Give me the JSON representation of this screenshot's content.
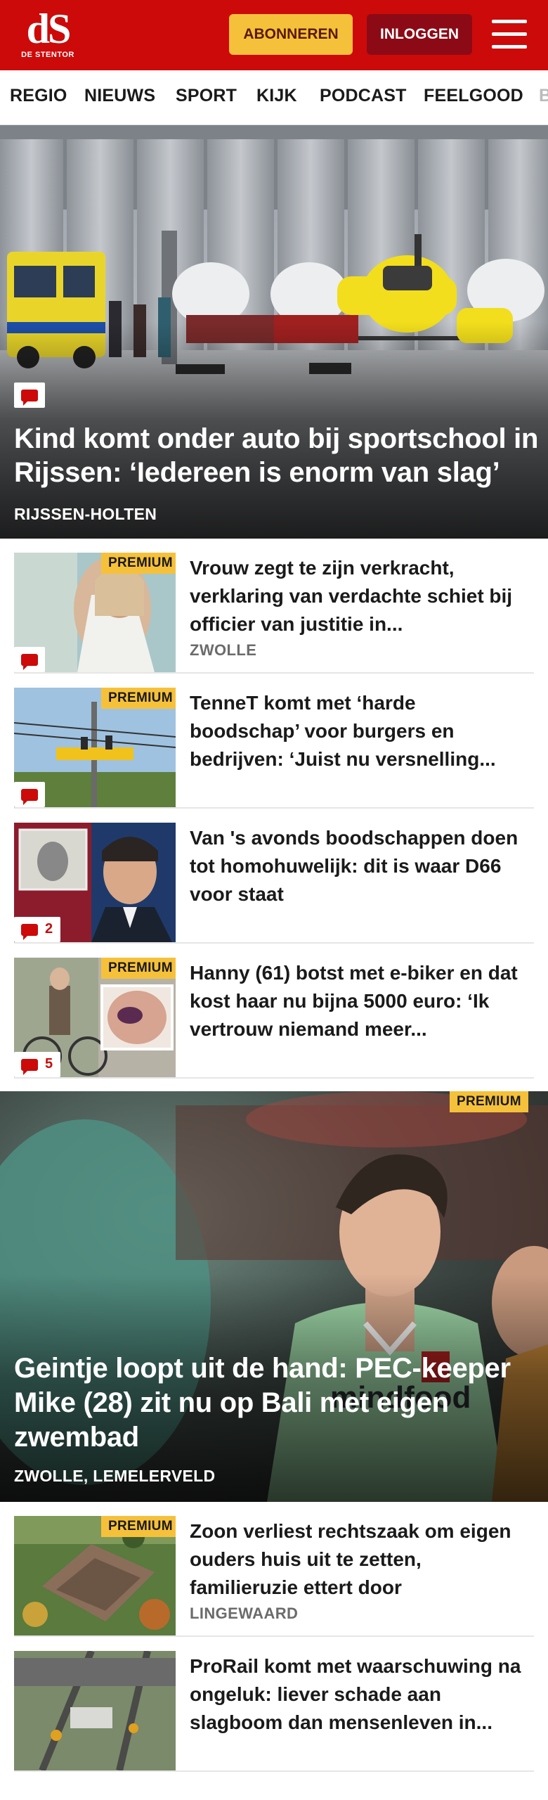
{
  "header": {
    "logo_text": "dS",
    "logo_subtitle": "DE STENTOR",
    "subscribe_label": "ABONNEREN",
    "login_label": "INLOGGEN",
    "brand_color": "#cc0a0a",
    "accent_color": "#f6c13a"
  },
  "nav": {
    "items": [
      "REGIO",
      "NIEUWS",
      "SPORT",
      "KIJK",
      "PODCAST",
      "FEELGOOD",
      "B"
    ]
  },
  "hero": {
    "title": "Kind komt onder auto bij sportschool in Rijssen: ‘Iedereen is enorm van slag’",
    "location": "RIJSSEN-HOLTEN",
    "comment_icon": "comment-icon"
  },
  "articles": [
    {
      "premium": "PREMIUM",
      "title": "Vrouw zegt te zijn verkracht, verklaring van verdachte schiet bij officier van justitie in...",
      "location": "ZWOLLE",
      "comments": ""
    },
    {
      "premium": "PREMIUM",
      "title": "TenneT komt met ‘harde boodschap’ voor burgers en bedrijven: ‘Juist nu versnelling...",
      "location": "",
      "comments": ""
    },
    {
      "premium": "",
      "title": "Van 's avonds boodschappen doen tot homohuwelijk: dit is waar D66 voor staat",
      "location": "",
      "comments": "2"
    },
    {
      "premium": "PREMIUM",
      "title": "Hanny (61) botst met e-biker en dat kost haar nu bijna 5000 euro: ‘Ik vertrouw niemand meer...",
      "location": "",
      "comments": "5"
    }
  ],
  "feature": {
    "premium": "PREMIUM",
    "title": "Geintje loopt uit de hand: PEC-keeper Mike (28) zit nu op Bali met eigen zwembad",
    "location": "ZWOLLE, LEMELERVELD",
    "jersey_text": "mindfood"
  },
  "articles_bottom": [
    {
      "premium": "PREMIUM",
      "title": "Zoon verliest rechtszaak om eigen ouders huis uit te zetten, familieruzie ettert door",
      "location": "LINGEWAARD"
    },
    {
      "premium": "",
      "title": "ProRail komt met waarschuwing na ongeluk: liever schade aan slagboom dan mensenleven in...",
      "location": ""
    }
  ]
}
